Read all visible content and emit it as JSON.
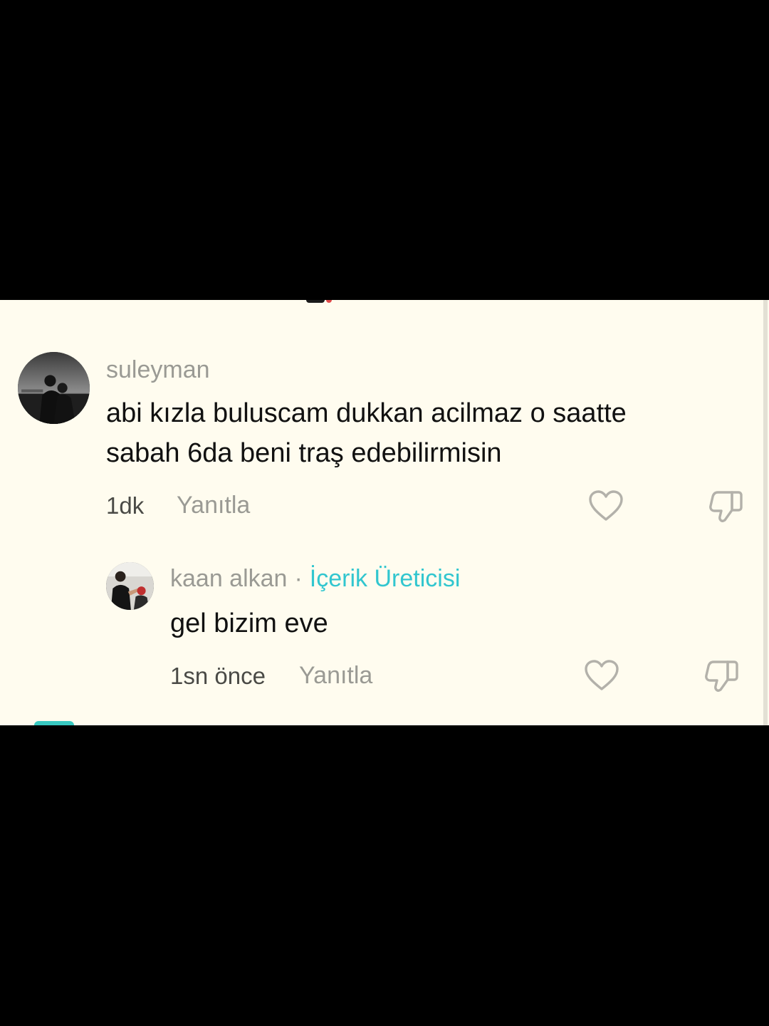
{
  "colors": {
    "panel_background": "#fffcef",
    "text_primary": "#111111",
    "text_muted": "#9a9a94",
    "creator_badge": "#31c6cf"
  },
  "comments": [
    {
      "username": "suleyman",
      "avatar_icon": "user-avatar-photo",
      "text_lines": [
        "abi kızla buluscam dukkan acilmaz o saatte",
        "sabah 6da beni traş edebilirmisin"
      ],
      "time": "1dk",
      "reply_label": "Yanıtla",
      "like_icon": "heart-icon",
      "dislike_icon": "thumbs-down-icon"
    }
  ],
  "replies": [
    {
      "username": "kaan alkan",
      "separator": "·",
      "badge": "İçerik Üreticisi",
      "avatar_icon": "user-avatar-photo",
      "text": "gel bizim eve",
      "time": "1sn önce",
      "reply_label": "Yanıtla",
      "like_icon": "heart-icon",
      "dislike_icon": "thumbs-down-icon"
    }
  ]
}
